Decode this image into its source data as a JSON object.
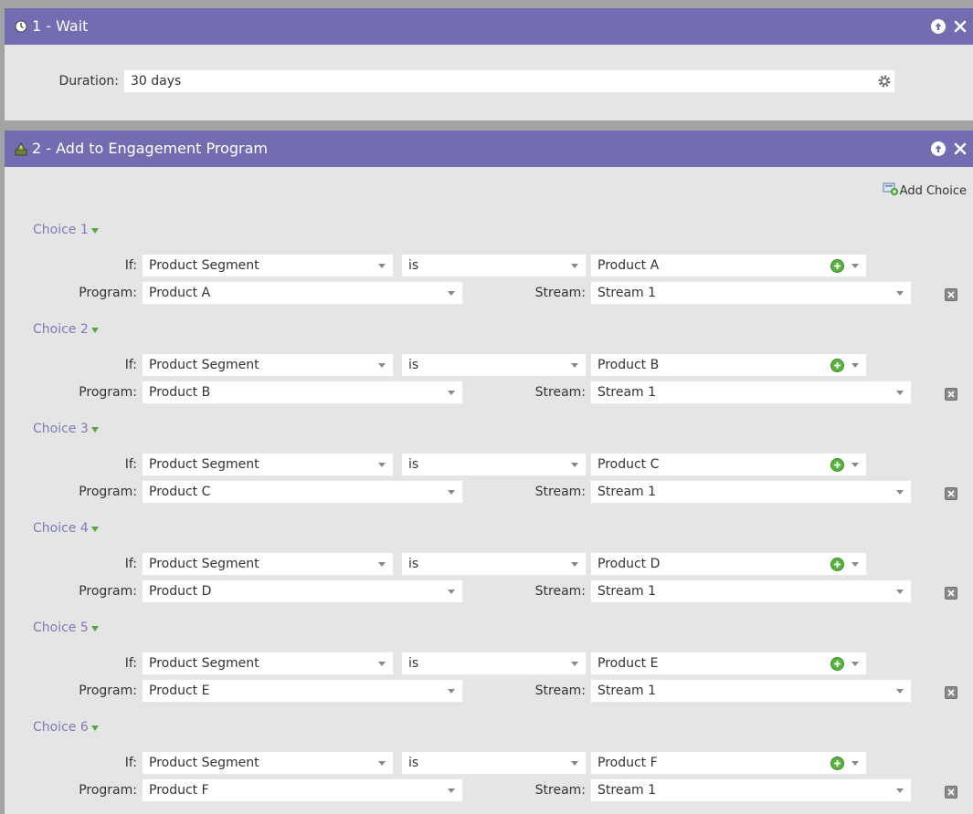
{
  "steps": [
    {
      "title": "1 - Wait",
      "icon": "clock-icon",
      "duration_label": "Duration:",
      "duration_value": "30 days"
    },
    {
      "title": "2 - Add to Engagement Program",
      "icon": "engagement-program-icon",
      "add_choice_label": "Add Choice",
      "if_label": "If:",
      "program_label": "Program:",
      "stream_label": "Stream:",
      "choices": [
        {
          "title": "Choice 1",
          "attribute": "Product Segment",
          "operator": "is",
          "value": "Product A",
          "program": "Product A",
          "stream": "Stream 1"
        },
        {
          "title": "Choice 2",
          "attribute": "Product Segment",
          "operator": "is",
          "value": "Product B",
          "program": "Product B",
          "stream": "Stream 1"
        },
        {
          "title": "Choice 3",
          "attribute": "Product Segment",
          "operator": "is",
          "value": "Product C",
          "program": "Product C",
          "stream": "Stream 1"
        },
        {
          "title": "Choice 4",
          "attribute": "Product Segment",
          "operator": "is",
          "value": "Product D",
          "program": "Product D",
          "stream": "Stream 1"
        },
        {
          "title": "Choice 5",
          "attribute": "Product Segment",
          "operator": "is",
          "value": "Product E",
          "program": "Product E",
          "stream": "Stream 1"
        },
        {
          "title": "Choice 6",
          "attribute": "Product Segment",
          "operator": "is",
          "value": "Product F",
          "program": "Product F",
          "stream": "Stream 1"
        }
      ]
    }
  ],
  "colors": {
    "header": "#726cb0",
    "panel": "#e5e5e5",
    "choice_title": "#7c7bb5",
    "add_icon": "#57b33d"
  }
}
